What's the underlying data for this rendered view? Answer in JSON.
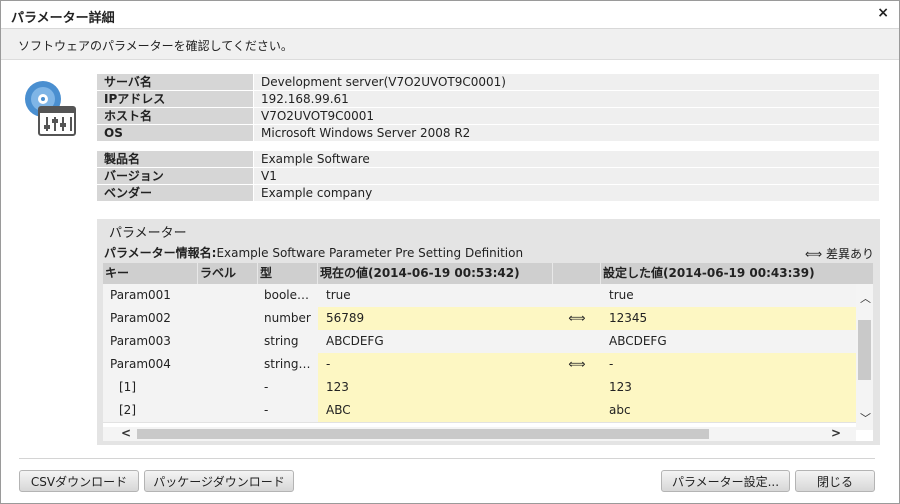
{
  "window": {
    "title": "パラメーター詳細",
    "close": "×"
  },
  "description": "ソフトウェアのパラメーターを確認してください。",
  "server_info": [
    {
      "key": "サーバ名",
      "value": "Development server(V7O2UVOT9C0001)"
    },
    {
      "key": "IPアドレス",
      "value": "192.168.99.61"
    },
    {
      "key": "ホスト名",
      "value": "V7O2UVOT9C0001"
    },
    {
      "key": "OS",
      "value": "Microsoft Windows Server 2008 R2"
    }
  ],
  "product_info": [
    {
      "key": "製品名",
      "value": "Example Software"
    },
    {
      "key": "バージョン",
      "value": "V1"
    },
    {
      "key": "ベンダー",
      "value": "Example company"
    }
  ],
  "params": {
    "title": "パラメーター",
    "info_label": "パラメーター情報名:",
    "info_name": "Example Software Parameter Pre Setting Definition",
    "legend_icon": "⟺",
    "legend_label": "差異あり",
    "columns": {
      "key": "キー",
      "label": "ラベル",
      "type": "型",
      "current": "現在の値(2014-06-19 00:53:42)",
      "diff": "",
      "set": "設定した値(2014-06-19 00:43:39)"
    },
    "rows": [
      {
        "key": "Param001",
        "label": "",
        "type": "boole…",
        "current": "true",
        "diff": "",
        "set": "true",
        "differs": false
      },
      {
        "key": "Param002",
        "label": "",
        "type": "number",
        "current": "56789",
        "diff": "⟺",
        "set": "12345",
        "differs": true
      },
      {
        "key": "Param003",
        "label": "",
        "type": "string",
        "current": "ABCDEFG",
        "diff": "",
        "set": "ABCDEFG",
        "differs": false
      },
      {
        "key": "Param004",
        "label": "",
        "type": "string…",
        "current": "-",
        "diff": "⟺",
        "set": "-",
        "differs": true
      },
      {
        "key": "[1]",
        "label": "",
        "type": "-",
        "current": "123",
        "diff": "",
        "set": "123",
        "differs": true
      },
      {
        "key": "[2]",
        "label": "",
        "type": "-",
        "current": "ABC",
        "diff": "",
        "set": "abc",
        "differs": true
      }
    ]
  },
  "buttons": {
    "csv": "CSVダウンロード",
    "package": "パッケージダウンロード",
    "param_setting": "パラメーター設定...",
    "close": "閉じる"
  },
  "colors": {
    "diff_highlight": "#fdf7c3",
    "header_bg": "#cfcfcf",
    "key_bg": "#d6d6d6"
  },
  "icons": {
    "app": "disc-settings-icon",
    "diff": "double-arrow-icon"
  }
}
